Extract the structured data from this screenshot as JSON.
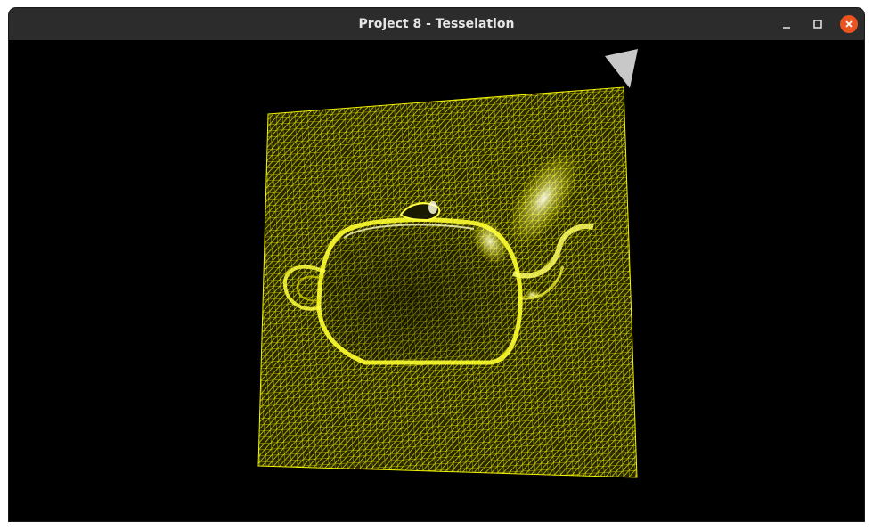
{
  "window": {
    "title": "Project 8 - Tesselation"
  },
  "controls": {
    "minimize_icon": "minimize-icon",
    "maximize_icon": "maximize-icon",
    "close_icon": "close-icon"
  },
  "colors": {
    "titlebar": "#2c2c2c",
    "title_text": "#e6e6e6",
    "close_button": "#e95420",
    "canvas_background": "#000000",
    "wireframe": "#f2f200",
    "light_marker": "#c8c8c8"
  },
  "scene": {
    "mesh": "tessellated-plane-wireframe",
    "relief": "teapot",
    "light": "light-indicator"
  }
}
